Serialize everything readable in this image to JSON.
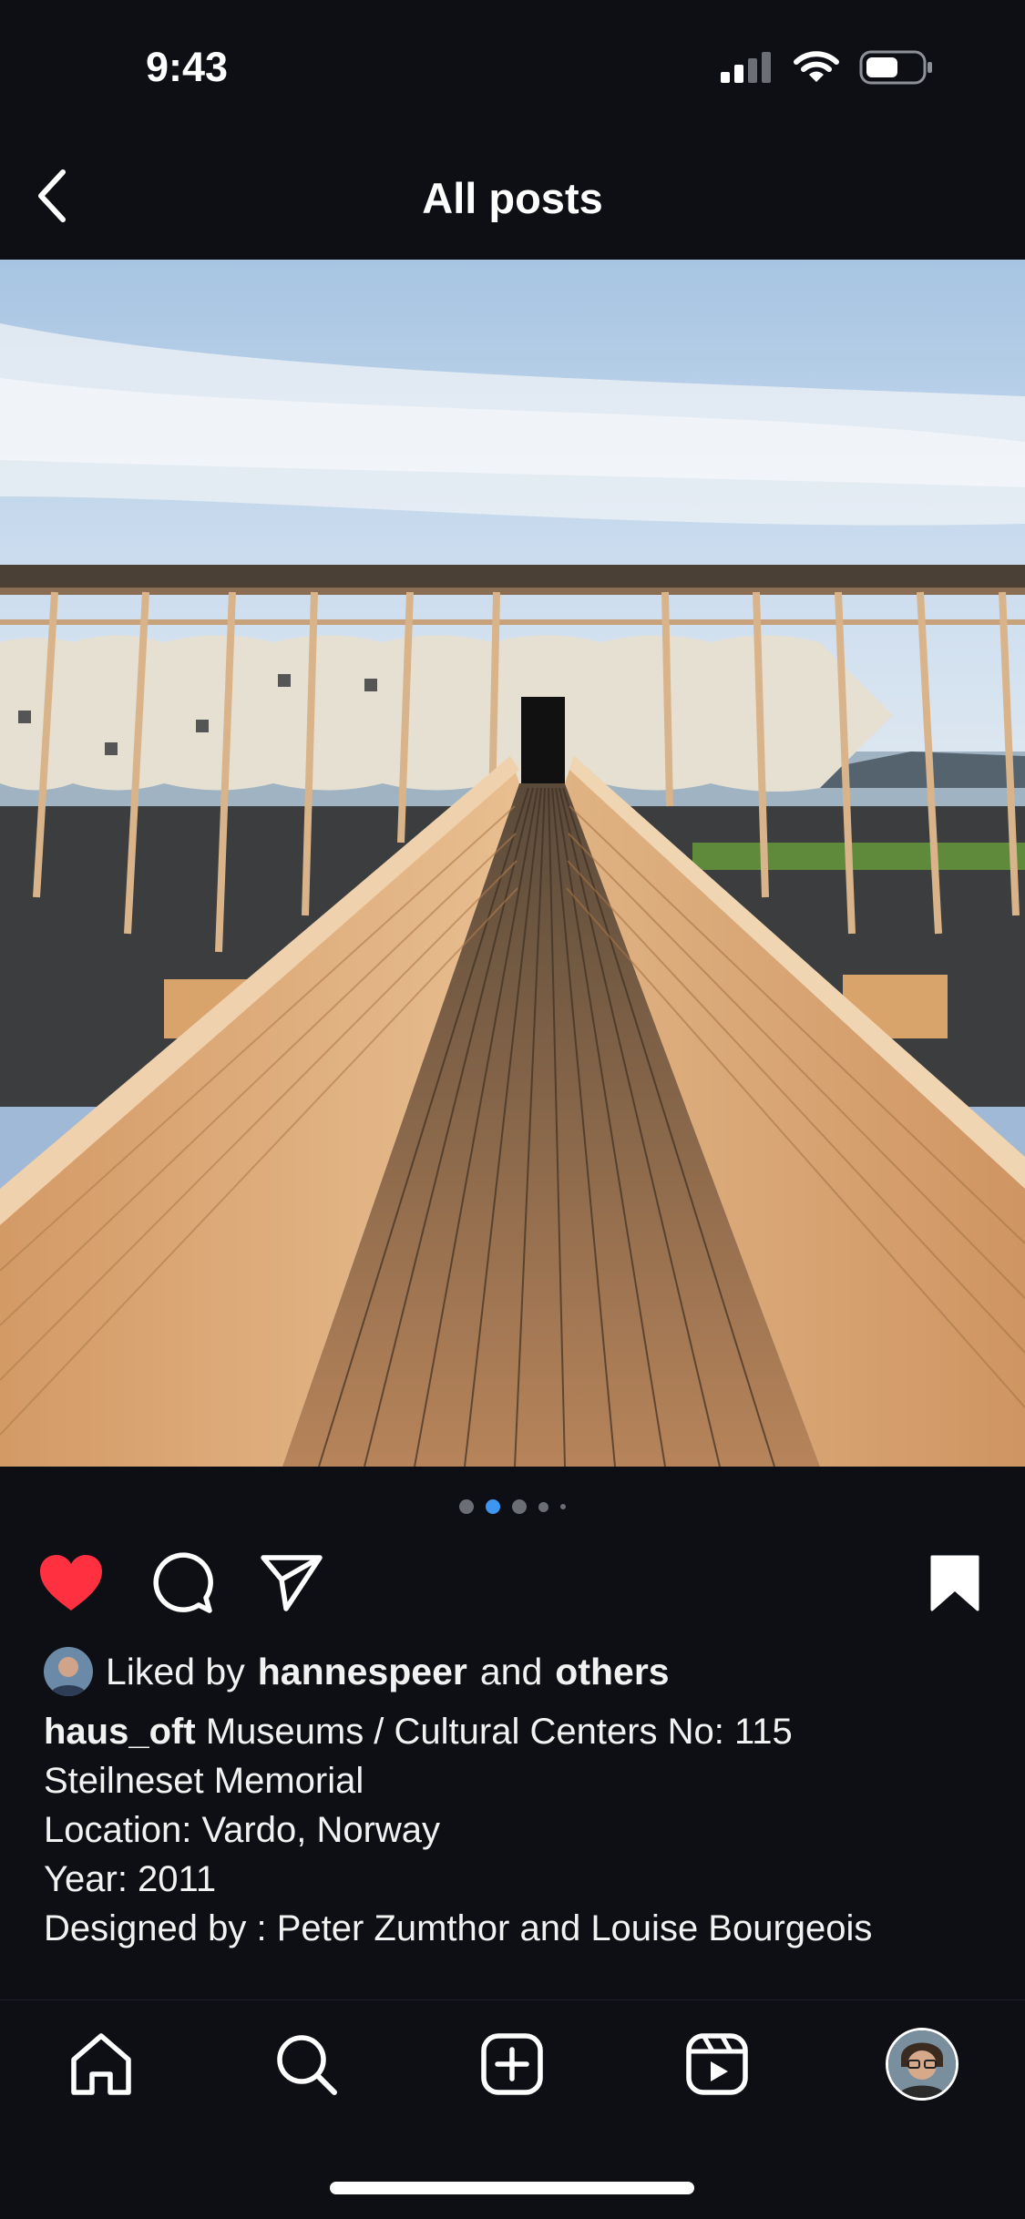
{
  "status": {
    "time": "9:43"
  },
  "header": {
    "title": "All posts"
  },
  "post": {
    "carousel": {
      "count": 5,
      "active_index": 1
    },
    "likes": {
      "prefix": "Liked by",
      "user": "hannespeer",
      "conj": "and",
      "others": "others"
    },
    "caption": {
      "username": "haus_oft",
      "line1": "Museums / Cultural Centers No: 115",
      "line2": "Steilneset Memorial",
      "line3": "Location: Vardo, Norway",
      "line4": "Year: 2011",
      "line5": "Designed by : Peter Zumthor and Louise Bourgeois"
    },
    "liked": true,
    "saved": true
  },
  "tabbar": {
    "items": [
      "home-icon",
      "search-icon",
      "create-icon",
      "reels-icon",
      "profile-avatar"
    ]
  },
  "colors": {
    "background": "#0d0f14",
    "heart": "#ff3040",
    "carousel_active": "#3d97f0"
  }
}
